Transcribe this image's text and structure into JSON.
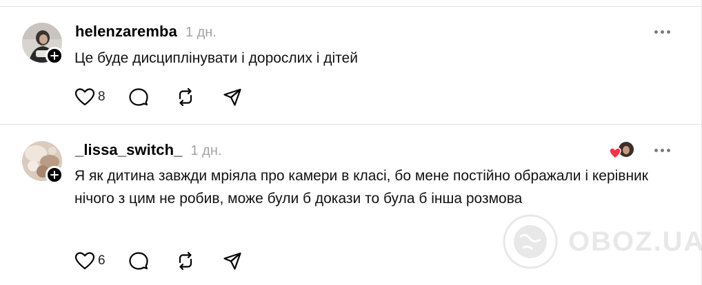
{
  "comments": [
    {
      "username": "helenzaremba",
      "time": "1 дн.",
      "text": "Це буде дисциплінувати і дорослих і дітей",
      "likes": "8"
    },
    {
      "username": "_lissa_switch_",
      "time": "1 дн.",
      "text": "Я як дитина завжди мріяла про камери в класі, бо мене постійно ображали і керівник нічого з цим не робив, може були б докази то була б інша розмова",
      "likes": "6"
    }
  ],
  "watermark": {
    "text": "OBOZ.UA"
  },
  "icons": [
    "heart-icon",
    "comment-icon",
    "repost-icon",
    "share-icon",
    "more-icon",
    "follow-plus-icon"
  ],
  "colors": {
    "liked_heart": "#ff3040",
    "time_gray": "#a3a3a3",
    "icon": "#000000"
  }
}
